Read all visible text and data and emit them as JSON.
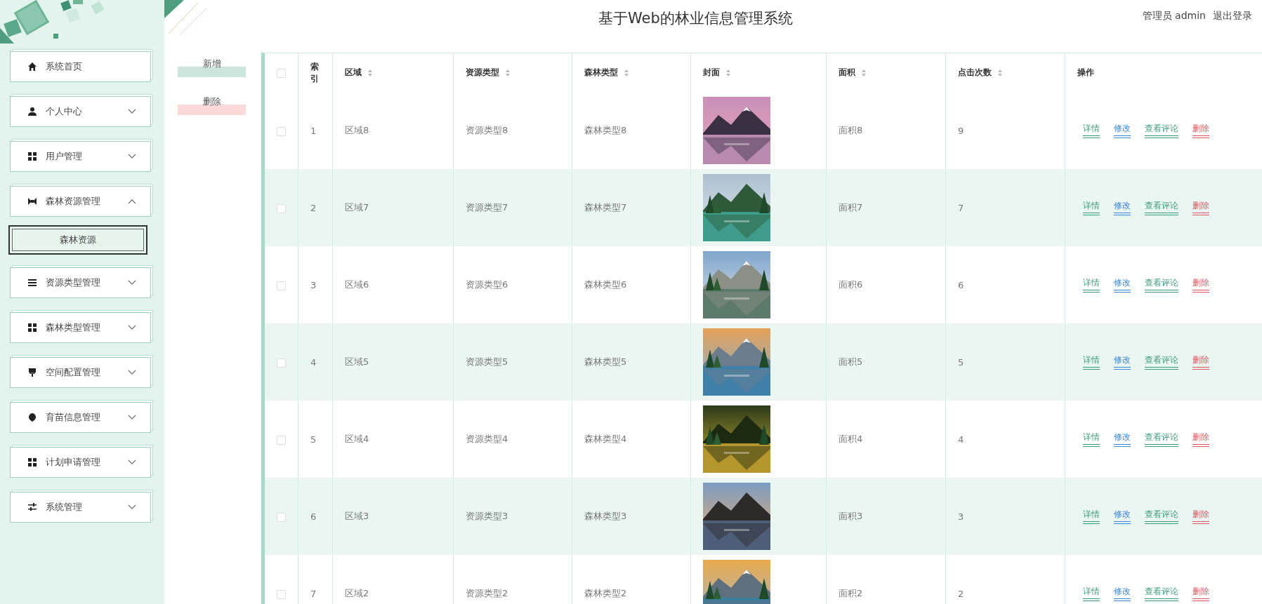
{
  "header": {
    "title": "基于Web的林业信息管理系统",
    "user": "管理员 admin",
    "logout": "退出登录"
  },
  "sidebar": {
    "items": [
      {
        "label": "系统首页"
      },
      {
        "label": "个人中心",
        "expanded": false
      },
      {
        "label": "用户管理",
        "expanded": false
      },
      {
        "label": "森林资源管理",
        "expanded": true,
        "children": [
          {
            "label": "森林资源",
            "selected": true
          }
        ]
      },
      {
        "label": "资源类型管理",
        "expanded": false
      },
      {
        "label": "森林类型管理",
        "expanded": false
      },
      {
        "label": "空间配置管理",
        "expanded": false
      },
      {
        "label": "育苗信息管理",
        "expanded": false
      },
      {
        "label": "计划申请管理",
        "expanded": false
      },
      {
        "label": "系统管理",
        "expanded": false
      }
    ]
  },
  "toolbar": {
    "buttons": [
      {
        "label": "新增",
        "color": "#cde6dd"
      },
      {
        "label": "删除",
        "color": "#fbd9d9"
      }
    ]
  },
  "table": {
    "header_checked": false,
    "columns": [
      {
        "label": "索引",
        "sortable": false
      },
      {
        "label": "区域",
        "sortable": true
      },
      {
        "label": "资源类型",
        "sortable": true
      },
      {
        "label": "森林类型",
        "sortable": true
      },
      {
        "label": "封面",
        "sortable": true
      },
      {
        "label": "面积",
        "sortable": true
      },
      {
        "label": "点击次数",
        "sortable": true
      },
      {
        "label": "操作",
        "sortable": false
      }
    ],
    "rows": [
      {
        "checked": false,
        "cells": [
          "1",
          "区域8",
          "资源类型8",
          "森林类型8",
          {
            "kind": "picture"
          },
          "面积8",
          "9"
        ],
        "actions": [
          {
            "label": "详情",
            "color": "#3a9a78"
          },
          {
            "label": "修改",
            "color": "#3b86d4"
          },
          {
            "label": "查看评论",
            "color": "#3a9a78"
          },
          {
            "label": "删除",
            "color": "#e0555e"
          }
        ]
      },
      {
        "checked": false,
        "cells": [
          "2",
          "区域7",
          "资源类型7",
          "森林类型7",
          {
            "kind": "picture"
          },
          "面积7",
          "7"
        ],
        "actions": [
          {
            "label": "详情",
            "color": "#3a9a78"
          },
          {
            "label": "修改",
            "color": "#3b86d4"
          },
          {
            "label": "查看评论",
            "color": "#3a9a78"
          },
          {
            "label": "删除",
            "color": "#e0555e"
          }
        ]
      },
      {
        "checked": false,
        "cells": [
          "3",
          "区域6",
          "资源类型6",
          "森林类型6",
          {
            "kind": "picture"
          },
          "面积6",
          "6"
        ],
        "actions": [
          {
            "label": "详情",
            "color": "#3a9a78"
          },
          {
            "label": "修改",
            "color": "#3b86d4"
          },
          {
            "label": "查看评论",
            "color": "#3a9a78"
          },
          {
            "label": "删除",
            "color": "#e0555e"
          }
        ]
      },
      {
        "checked": false,
        "cells": [
          "4",
          "区域5",
          "资源类型5",
          "森林类型5",
          {
            "kind": "picture"
          },
          "面积5",
          "5"
        ],
        "actions": [
          {
            "label": "详情",
            "color": "#3a9a78"
          },
          {
            "label": "修改",
            "color": "#3b86d4"
          },
          {
            "label": "查看评论",
            "color": "#3a9a78"
          },
          {
            "label": "删除",
            "color": "#e0555e"
          }
        ]
      },
      {
        "checked": false,
        "cells": [
          "5",
          "区域4",
          "资源类型4",
          "森林类型4",
          {
            "kind": "picture"
          },
          "面积4",
          "4"
        ],
        "actions": [
          {
            "label": "详情",
            "color": "#3a9a78"
          },
          {
            "label": "修改",
            "color": "#3b86d4"
          },
          {
            "label": "查看评论",
            "color": "#3a9a78"
          },
          {
            "label": "删除",
            "color": "#e0555e"
          }
        ]
      },
      {
        "checked": false,
        "cells": [
          "6",
          "区域3",
          "资源类型3",
          "森林类型3",
          {
            "kind": "picture"
          },
          "面积3",
          "3"
        ],
        "actions": [
          {
            "label": "详情",
            "color": "#3a9a78"
          },
          {
            "label": "修改",
            "color": "#3b86d4"
          },
          {
            "label": "查看评论",
            "color": "#3a9a78"
          },
          {
            "label": "删除",
            "color": "#e0555e"
          }
        ]
      },
      {
        "checked": false,
        "cells": [
          "7",
          "区域2",
          "资源类型2",
          "森林类型2",
          {
            "kind": "picture"
          },
          "面积2",
          "2"
        ],
        "actions": [
          {
            "label": "详情",
            "color": "#3a9a78"
          },
          {
            "label": "修改",
            "color": "#3b86d4"
          },
          {
            "label": "查看评论",
            "color": "#3a9a78"
          },
          {
            "label": "删除",
            "color": "#e0555e"
          }
        ]
      }
    ]
  }
}
